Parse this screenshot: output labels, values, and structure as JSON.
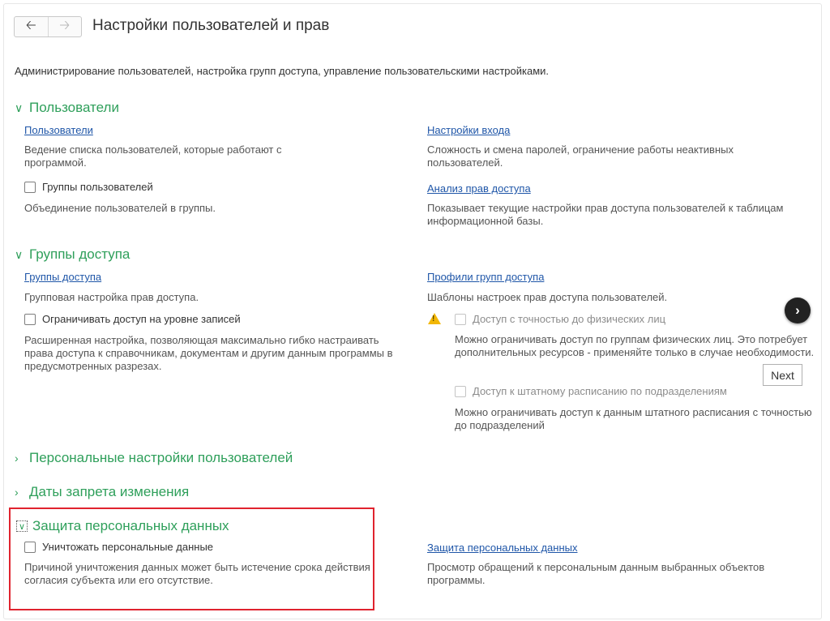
{
  "nav": {
    "back_icon": "arrow-left",
    "forward_icon": "arrow-right"
  },
  "title": "Настройки пользователей и прав",
  "description": "Администрирование пользователей, настройка групп доступа, управление пользовательскими настройками.",
  "sections": {
    "users": {
      "title": "Пользователи",
      "users_link": "Пользователи",
      "users_help": "Ведение списка пользователей, которые работают с программой.",
      "user_groups_checkbox": "Группы пользователей",
      "user_groups_help": "Объединение пользователей в группы.",
      "login_settings_link": "Настройки входа",
      "login_settings_help": "Сложность и смена паролей, ограничение работы неактивных пользователей.",
      "rights_analysis_link": "Анализ прав доступа",
      "rights_analysis_help": "Показывает текущие настройки прав доступа пользователей к таблицам информационной базы."
    },
    "access_groups": {
      "title": "Группы доступа",
      "groups_link": "Группы доступа",
      "groups_help": "Групповая настройка прав доступа.",
      "record_level_checkbox": "Ограничивать доступ на уровне записей",
      "record_level_help": "Расширенная настройка, позволяющая максимально гибко настраивать права доступа к справочникам, документам и другим данным программы в предусмотренных разрезах.",
      "profiles_link": "Профили групп доступа",
      "profiles_help": "Шаблоны настроек прав доступа пользователей.",
      "individuals_checkbox": "Доступ с точностью до физических лиц",
      "individuals_help": "Можно ограничивать доступ по группам физических лиц. Это потребует дополнительных ресурсов - применяйте только в случае необходимости.",
      "staffing_checkbox": "Доступ к штатному расписанию по подразделениям",
      "staffing_help": "Можно ограничивать доступ к данным штатного расписания с точностью до подразделений"
    },
    "personal_settings": {
      "title": "Персональные настройки пользователей"
    },
    "change_prohibition": {
      "title": "Даты запрета изменения"
    },
    "personal_data": {
      "title": "Защита персональных данных",
      "destroy_checkbox": "Уничтожать персональные данные",
      "destroy_help": "Причиной уничтожения данных может быть истечение срока действия согласия субъекта или его отсутствие.",
      "protection_link": "Защита персональных данных",
      "protection_help": "Просмотр обращений к персональным данным выбранных объектов программы."
    }
  },
  "tour": {
    "next_label": "Next"
  },
  "colors": {
    "section_green": "#2e9f5a",
    "link_blue": "#1f56a8",
    "highlight_red": "#e0232e",
    "warning_yellow": "#f2b705"
  }
}
